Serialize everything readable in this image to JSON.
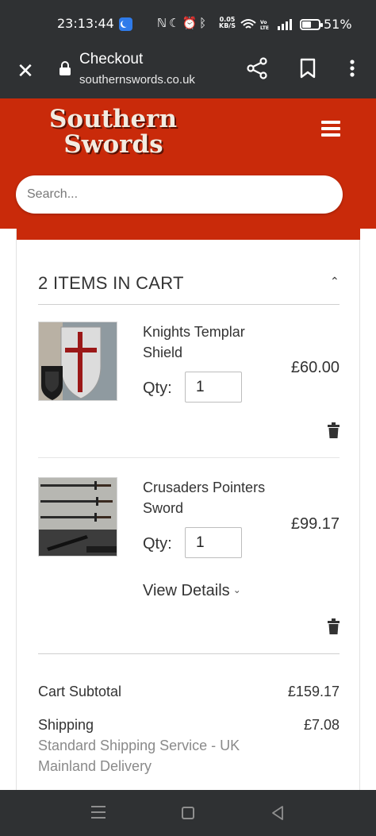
{
  "status_bar": {
    "time": "23:13:44",
    "net_speed_value": "0.05",
    "net_speed_unit": "KB/S",
    "battery": "51%"
  },
  "browser": {
    "title": "Checkout",
    "url": "southernswords.co.uk"
  },
  "site": {
    "logo_line1": "Southern",
    "logo_line2": "Swords",
    "brand_color": "#c92a0a",
    "search_placeholder": "Search..."
  },
  "cart": {
    "heading": "2 ITEMS IN CART",
    "qty_label": "Qty:",
    "items": [
      {
        "name": "Knights Templar Shield",
        "price": "£60.00",
        "qty": "1"
      },
      {
        "name": "Crusaders Pointers Sword",
        "price": "£99.17",
        "qty": "1",
        "details_label": "View Details"
      }
    ]
  },
  "summary": {
    "subtotal_label": "Cart Subtotal",
    "subtotal_value": "£159.17",
    "shipping_label": "Shipping",
    "shipping_value": "£7.08",
    "shipping_method": "Standard Shipping Service - UK Mainland Delivery"
  },
  "icons": {
    "close": "close-icon",
    "lock": "lock-icon",
    "share": "share-icon",
    "bookmark": "bookmark-icon",
    "more": "more-vertical-icon",
    "menu": "hamburger-menu-icon",
    "collapse": "chevron-up-icon",
    "delete": "trash-icon"
  }
}
